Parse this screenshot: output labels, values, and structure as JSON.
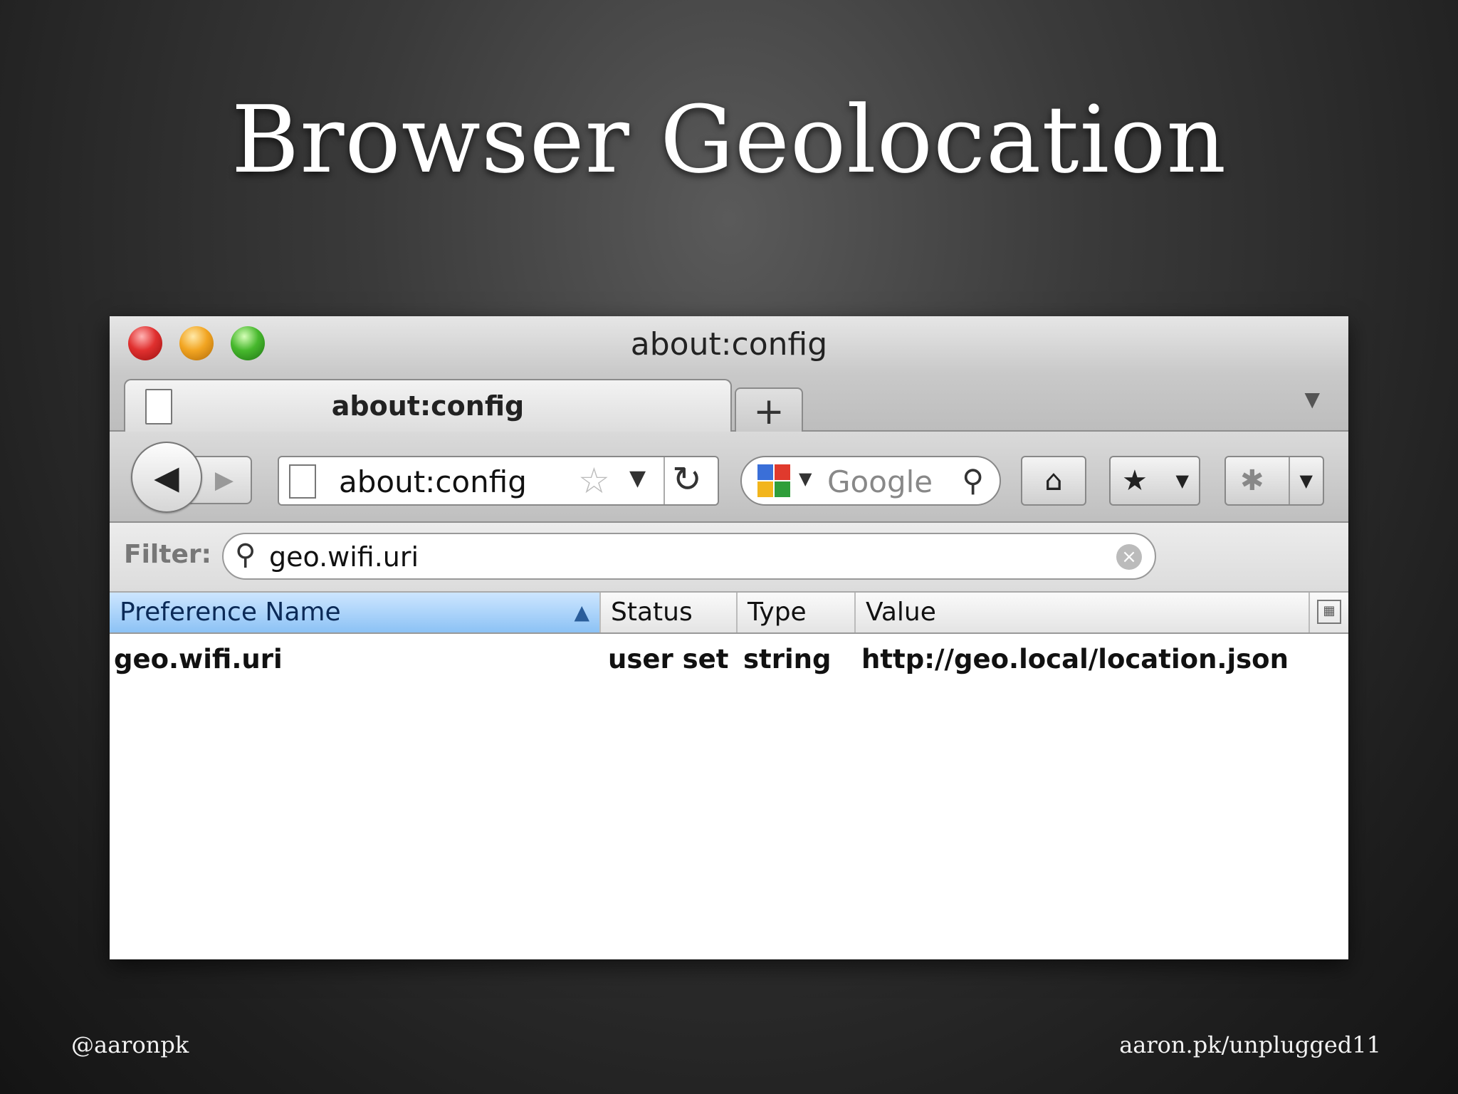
{
  "slide": {
    "title": "Browser Geolocation",
    "footer_left": "@aaronpk",
    "footer_right": "aaron.pk/unplugged11"
  },
  "window": {
    "title": "about:config"
  },
  "tabs": [
    {
      "label": "about:config",
      "active": true
    }
  ],
  "newtab_label": "+",
  "navbar": {
    "url": "about:config",
    "search_engine": "Google"
  },
  "filter": {
    "label": "Filter:",
    "value": "geo.wifi.uri"
  },
  "table": {
    "columns": [
      "Preference Name",
      "Status",
      "Type",
      "Value"
    ],
    "sorted_column": "Preference Name",
    "rows": [
      {
        "name": "geo.wifi.uri",
        "status": "user set",
        "type": "string",
        "value": "http://geo.local/location.json"
      }
    ]
  },
  "colors": {
    "close": "#e0302f",
    "minimize": "#f2a522",
    "zoom": "#47b82d",
    "sorted_header": "#8cc2f5"
  }
}
